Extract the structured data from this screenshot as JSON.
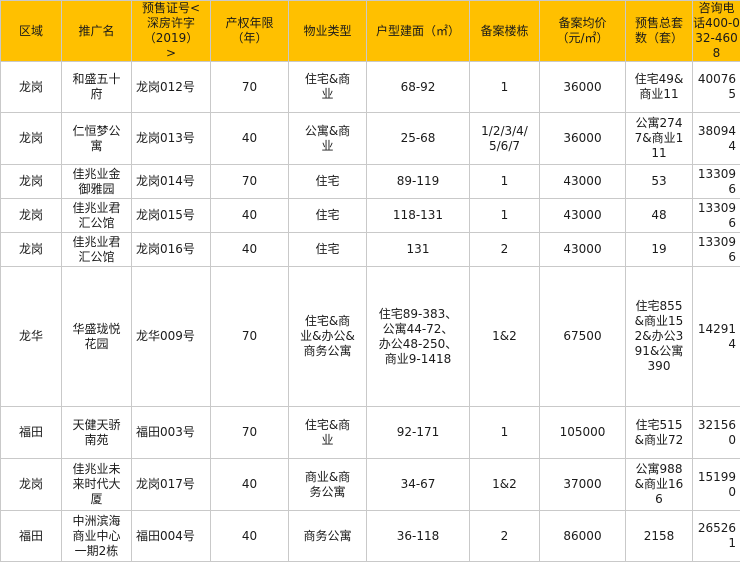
{
  "columns": [
    "区域",
    "推广名",
    "预售证号<深房许字（2019）>",
    "产权年限（年）",
    "物业类型",
    "户型建面（㎡）",
    "备案楼栋",
    "备案均价（元/㎡）",
    "预售总套数（套）",
    "咨询电话400-032-4608"
  ],
  "rows": [
    {
      "district": "龙岗",
      "name": "和盛五十府",
      "permit": "龙岗012号",
      "years": "70",
      "type": "住宅&商业",
      "area": "68-92",
      "buildings": "1",
      "price": "36000",
      "units": "住宅49&商业11",
      "ext": "400765"
    },
    {
      "district": "龙岗",
      "name": "仁恒梦公寓",
      "permit": "龙岗013号",
      "years": "40",
      "type": "公寓&商业",
      "area": "25-68",
      "buildings": "1/2/3/4/5/6/7",
      "price": "36000",
      "units": "公寓2747&商业111",
      "ext": "380944"
    },
    {
      "district": "龙岗",
      "name": "佳兆业金御雅园",
      "permit": "龙岗014号",
      "years": "70",
      "type": "住宅",
      "area": "89-119",
      "buildings": "1",
      "price": "43000",
      "units": "53",
      "ext": "133096"
    },
    {
      "district": "龙岗",
      "name": "佳兆业君汇公馆",
      "permit": "龙岗015号",
      "years": "40",
      "type": "住宅",
      "area": "118-131",
      "buildings": "1",
      "price": "43000",
      "units": "48",
      "ext": "133096"
    },
    {
      "district": "龙岗",
      "name": "佳兆业君汇公馆",
      "permit": "龙岗016号",
      "years": "40",
      "type": "住宅",
      "area": "131",
      "buildings": "2",
      "price": "43000",
      "units": "19",
      "ext": "133096"
    },
    {
      "district": "龙华",
      "name": "华盛珑悦花园",
      "permit": "龙华009号",
      "years": "70",
      "type": "住宅&商业&办公&商务公寓",
      "area": "住宅89-383、公寓44-72、办公48-250、商业9-1418",
      "buildings": "1&2",
      "price": "67500",
      "units": "住宅855&商业152&办公391&公寓390",
      "ext": "142914"
    },
    {
      "district": "福田",
      "name": "天健天骄南苑",
      "permit": "福田003号",
      "years": "70",
      "type": "住宅&商业",
      "area": "92-171",
      "buildings": "1",
      "price": "105000",
      "units": "住宅515&商业72",
      "ext": "321560"
    },
    {
      "district": "龙岗",
      "name": "佳兆业未来时代大厦",
      "permit": "龙岗017号",
      "years": "40",
      "type": "商业&商务公寓",
      "area": "34-67",
      "buildings": "1&2",
      "price": "37000",
      "units": "公寓988&商业166",
      "ext": "151990"
    },
    {
      "district": "福田",
      "name": "中洲滨海商业中心一期2栋",
      "permit": "福田004号",
      "years": "40",
      "type": "商务公寓",
      "area": "36-118",
      "buildings": "2",
      "price": "86000",
      "units": "2158",
      "ext": "265261"
    }
  ]
}
